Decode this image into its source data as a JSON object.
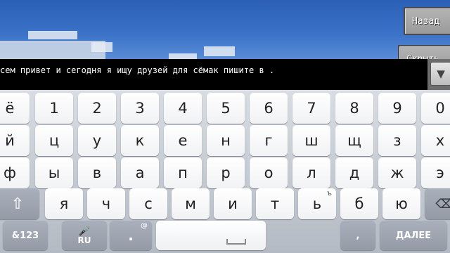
{
  "buttons": {
    "back": "Назад",
    "second": "Скрыть"
  },
  "chat": {
    "text": "сем привет и сегодня я ищу друзей для сёмак пишите в ."
  },
  "keyboard": {
    "row1": [
      "ё",
      "1",
      "2",
      "3",
      "4",
      "5",
      "6",
      "7",
      "8",
      "9",
      "0"
    ],
    "row2": [
      "й",
      "ц",
      "у",
      "к",
      "е",
      "н",
      "г",
      "ш",
      "щ",
      "з",
      "х"
    ],
    "row3": [
      "ф",
      "ы",
      "в",
      "а",
      "п",
      "р",
      "о",
      "л",
      "д",
      "ж",
      "э"
    ],
    "row4": [
      "я",
      "ч",
      "с",
      "м",
      "и",
      "т",
      "ь",
      "б",
      "ю"
    ],
    "row4_sub": "ъ",
    "symbols_label": "&123",
    "lang_label": "RU",
    "period_label": ".",
    "period_sub": "@",
    "comma_label": ",",
    "enter_label": "ДАЛЕЕ"
  }
}
